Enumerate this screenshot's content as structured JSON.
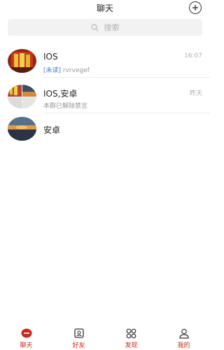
{
  "header": {
    "title": "聊天"
  },
  "search": {
    "placeholder": "搜索"
  },
  "chats": [
    {
      "name": "IOS",
      "unread_tag": "[未读]",
      "preview": " rvrvegef",
      "time": "16:07"
    },
    {
      "name": "IOS,安卓",
      "unread_tag": "",
      "preview": "本群已解除禁言",
      "time": "昨天"
    },
    {
      "name": "安卓",
      "unread_tag": "",
      "preview": "",
      "time": ""
    }
  ],
  "tabs": [
    {
      "label": "聊天",
      "icon": "chat-icon",
      "active": true
    },
    {
      "label": "好友",
      "icon": "contacts-icon",
      "active": false
    },
    {
      "label": "发现",
      "icon": "discover-icon",
      "active": false
    },
    {
      "label": "我的",
      "icon": "profile-icon",
      "active": false
    }
  ],
  "colors": {
    "accent": "#c8281e",
    "unread": "#4a7fd6",
    "icon": "#333333"
  }
}
